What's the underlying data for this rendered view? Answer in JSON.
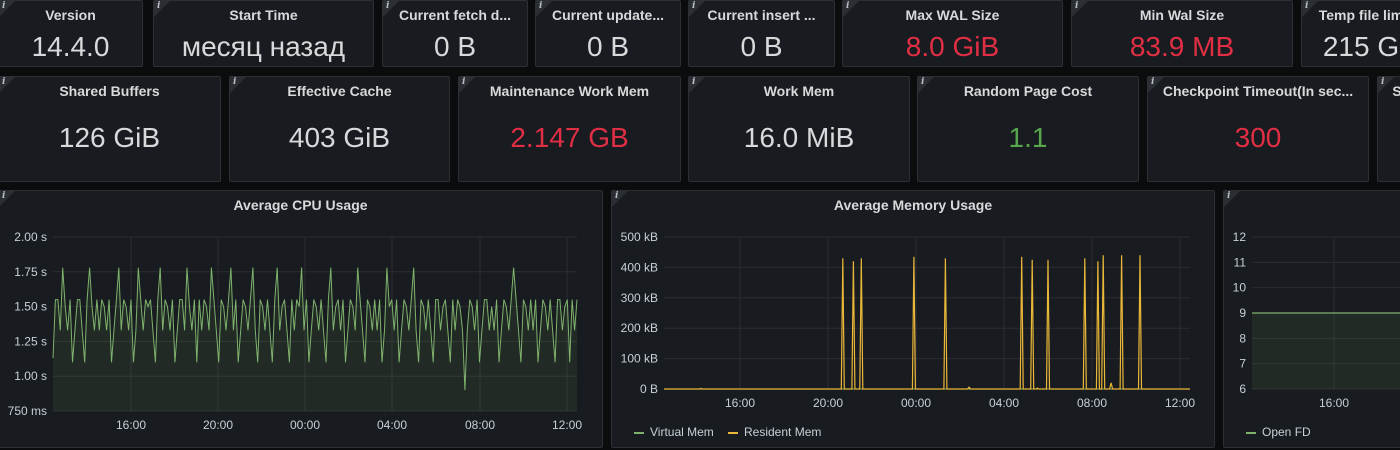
{
  "row1": [
    {
      "title": "Version",
      "value": "14.4.0",
      "color": "#d8d9da"
    },
    {
      "title": "Start Time",
      "value": "месяц назад",
      "color": "#d8d9da"
    },
    {
      "title": "Current fetch d...",
      "value": "0 B",
      "color": "#d8d9da"
    },
    {
      "title": "Current update...",
      "value": "0 B",
      "color": "#d8d9da"
    },
    {
      "title": "Current insert ...",
      "value": "0 B",
      "color": "#d8d9da"
    },
    {
      "title": "Max WAL Size",
      "value": "8.0 GiB",
      "color": "#e02f44"
    },
    {
      "title": "Min Wal Size",
      "value": "83.9 MB",
      "color": "#e02f44"
    },
    {
      "title": "Temp file lim",
      "value": "215 G",
      "color": "#d8d9da"
    }
  ],
  "row2": [
    {
      "title": "Shared Buffers",
      "value": "126 GiB",
      "color": "#d8d9da"
    },
    {
      "title": "Effective Cache",
      "value": "403 GiB",
      "color": "#d8d9da"
    },
    {
      "title": "Maintenance Work Mem",
      "value": "2.147 GB",
      "color": "#e02f44"
    },
    {
      "title": "Work Mem",
      "value": "16.0 MiB",
      "color": "#d8d9da"
    },
    {
      "title": "Random Page Cost",
      "value": "1.1",
      "color": "#56a64b"
    },
    {
      "title": "Checkpoint Timeout(In sec...",
      "value": "300",
      "color": "#e02f44"
    },
    {
      "title": "S",
      "value": "",
      "color": "#d8d9da"
    }
  ],
  "chart_data": [
    {
      "type": "line",
      "title": "Average CPU Usage",
      "yticks": [
        "2.00 s",
        "1.75 s",
        "1.50 s",
        "1.25 s",
        "1.00 s",
        "750 ms"
      ],
      "ylim": [
        0.75,
        2.0
      ],
      "xticks": [
        "16:00",
        "20:00",
        "00:00",
        "04:00",
        "08:00",
        "12:00"
      ],
      "series": [
        {
          "color": "#7eb26d",
          "values": [
            1.13,
            1.55,
            1.55,
            1.33,
            1.78,
            1.5,
            1.33,
            1.55,
            1.1,
            1.33,
            1.55,
            1.55,
            1.33,
            1.1,
            1.55,
            1.78,
            1.5,
            1.33,
            1.55,
            1.33,
            1.55,
            1.5,
            1.33,
            1.55,
            1.1,
            1.33,
            1.55,
            1.78,
            1.33,
            1.55,
            1.5,
            1.33,
            1.55,
            1.1,
            1.33,
            1.78,
            1.55,
            1.33,
            1.55,
            1.5,
            1.55,
            1.33,
            1.1,
            1.55,
            1.78,
            1.33,
            1.55,
            1.5,
            1.33,
            1.55,
            1.1,
            1.33,
            1.55,
            1.55,
            1.33,
            1.78,
            1.5,
            1.33,
            1.55,
            1.1,
            1.55,
            1.33,
            1.55,
            1.5,
            1.33,
            1.78,
            1.55,
            1.33,
            1.1,
            1.55,
            1.5,
            1.33,
            1.55,
            1.78,
            1.33,
            1.55,
            1.1,
            1.33,
            1.55,
            1.5,
            1.33,
            1.55,
            1.78,
            1.33,
            1.1,
            1.55,
            1.5,
            1.33,
            1.55,
            1.33,
            1.1,
            1.55,
            1.78,
            1.33,
            1.5,
            1.55,
            1.33,
            1.1,
            1.55,
            1.33,
            1.55,
            1.5,
            1.78,
            1.33,
            1.55,
            1.1,
            1.33,
            1.55,
            1.5,
            1.33,
            1.55,
            1.33,
            1.1,
            1.55,
            1.78,
            1.33,
            1.5,
            1.55,
            1.33,
            1.55,
            1.1,
            1.33,
            1.55,
            1.5,
            1.33,
            1.78,
            1.55,
            1.33,
            1.1,
            1.55,
            1.5,
            1.33,
            1.55,
            1.33,
            1.55,
            1.1,
            1.33,
            1.78,
            1.5,
            1.55,
            1.33,
            1.55,
            1.1,
            1.33,
            1.55,
            1.5,
            1.33,
            1.55,
            1.78,
            1.33,
            1.1,
            1.55,
            1.5,
            1.33,
            1.55,
            1.33,
            1.1,
            1.55,
            1.55,
            1.33,
            1.5,
            1.55,
            1.33,
            1.1,
            1.55,
            1.33,
            1.55,
            1.5,
            1.33,
            0.9,
            1.33,
            1.55,
            1.5,
            1.33,
            1.55,
            1.1,
            1.33,
            1.55,
            1.55,
            1.33,
            1.5,
            1.33,
            1.55,
            1.1,
            1.33,
            1.55,
            1.5,
            1.33,
            1.55,
            1.78,
            1.55,
            1.33,
            1.1,
            1.55,
            1.5,
            1.33,
            1.55,
            1.33,
            1.55,
            1.1,
            1.33,
            1.55,
            1.5,
            1.33,
            1.55,
            1.33,
            1.1,
            1.55,
            1.55,
            1.33,
            1.5,
            1.55,
            1.1,
            1.55,
            1.33,
            1.55
          ]
        }
      ]
    },
    {
      "type": "line",
      "title": "Average Memory Usage",
      "yticks": [
        "500 kB",
        "400 kB",
        "300 kB",
        "200 kB",
        "100 kB",
        "0 B"
      ],
      "ylim": [
        0,
        500
      ],
      "xticks": [
        "16:00",
        "20:00",
        "00:00",
        "04:00",
        "08:00",
        "12:00"
      ],
      "spikes": [
        {
          "x": 0.34,
          "v": 430
        },
        {
          "x": 0.36,
          "v": 420
        },
        {
          "x": 0.375,
          "v": 430
        },
        {
          "x": 0.475,
          "v": 435
        },
        {
          "x": 0.535,
          "v": 430
        },
        {
          "x": 0.68,
          "v": 435
        },
        {
          "x": 0.7,
          "v": 425
        },
        {
          "x": 0.73,
          "v": 425
        },
        {
          "x": 0.8,
          "v": 430
        },
        {
          "x": 0.825,
          "v": 420
        },
        {
          "x": 0.835,
          "v": 440
        },
        {
          "x": 0.87,
          "v": 440
        },
        {
          "x": 0.905,
          "v": 440
        },
        {
          "x": 0.07,
          "v": 2
        },
        {
          "x": 0.58,
          "v": 6
        },
        {
          "x": 0.85,
          "v": 20
        },
        {
          "x": 0.71,
          "v": 3
        }
      ],
      "series": [
        {
          "name": "Virtual Mem",
          "color": "#7eb26d"
        },
        {
          "name": "Resident Mem",
          "color": "#eab839"
        }
      ]
    },
    {
      "type": "line",
      "title": "",
      "yticks": [
        "12",
        "11",
        "10",
        "9",
        "8",
        "7",
        "6"
      ],
      "ylim": [
        6,
        12
      ],
      "xticks": [
        "16:00"
      ],
      "series": [
        {
          "name": "Open FD",
          "color": "#7eb26d",
          "values": [
            9,
            9
          ]
        }
      ]
    }
  ]
}
